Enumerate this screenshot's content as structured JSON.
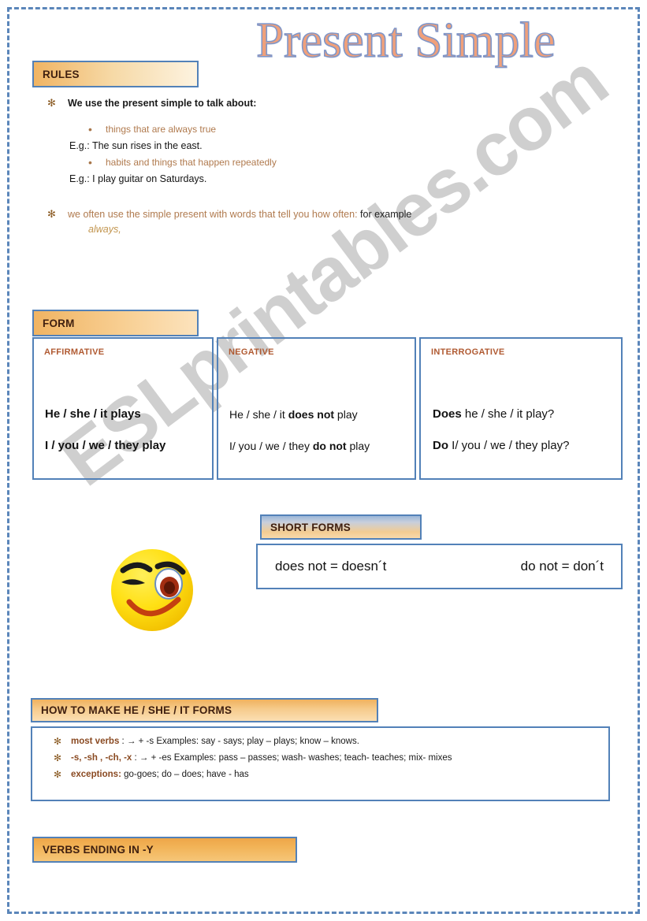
{
  "title": "Present Simple",
  "watermark": "ESLprintables.com",
  "sections": {
    "rules": {
      "header": "RULES",
      "rule1": {
        "bullet": "star-bullet-icon",
        "text": "We use the present simple to talk about:",
        "sub_items": [
          {
            "text": "things that are always true",
            "example": "E.g.: The sun rises in the east."
          },
          {
            "text": "habits and things that happen repeatedly",
            "example": "E.g.: I play guitar on Saturdays."
          }
        ]
      },
      "rule2": {
        "bullet": "star-bullet-icon",
        "text_tan": "we often use the simple present with words that tell you how often:",
        "text_dark": "for example",
        "italic": "always,"
      }
    },
    "form": {
      "header": "FORM",
      "columns": [
        {
          "label": "AFFIRMATIVE",
          "lines": [
            {
              "pre": "He / she / it  plays",
              "bold": "",
              "post": ""
            },
            {
              "pre": "I / you / we / they  play",
              "bold": "",
              "post": ""
            }
          ]
        },
        {
          "label": "NEGATIVE",
          "lines": [
            {
              "pre": "He / she / it   ",
              "bold": "does not",
              "post": "   play"
            },
            {
              "pre": "I/ you / we / they  ",
              "bold": "do not",
              "post": "   play"
            }
          ]
        },
        {
          "label": "INTERROGATIVE",
          "lines": [
            {
              "pre": "",
              "bold": "Does",
              "post": "   he / she / it    play?"
            },
            {
              "pre": "",
              "bold": "Do",
              "post": "   I/ you / we / they play?"
            }
          ]
        }
      ]
    },
    "short_forms": {
      "header": "SHORT FORMS",
      "items": [
        "does not = doesn´t",
        "do not = don´t"
      ]
    },
    "how_to_make": {
      "header": "HOW TO MAKE HE / SHE / IT FORMS",
      "lines": [
        {
          "bullet": "star-bullet-icon",
          "highlight": "most verbs",
          "rest": " : → + -s  Examples: say - says; play – plays; know – knows."
        },
        {
          "bullet": "star-bullet-icon",
          "highlight": "-s, -sh , -ch, -x",
          "rest": " : → + -es Examples: pass – passes; wash- washes; teach- teaches; mix- mixes"
        },
        {
          "bullet": "star-bullet-icon",
          "highlight": "exceptions:",
          "rest": " go-goes; do – does; have - has"
        }
      ]
    },
    "verbs_ending_y": {
      "header": "VERBS ENDING IN -Y"
    }
  },
  "colors": {
    "border_blue": "#5281b8",
    "header_orange": "#f0b463",
    "label_rust": "#b05a32",
    "body_tan": "#b07a4e",
    "title_fill": "#f0a07a",
    "title_stroke": "#8096c8"
  },
  "icons": {
    "smiley": "winking-smiley-face-icon",
    "star": "✻",
    "dot": "•"
  }
}
